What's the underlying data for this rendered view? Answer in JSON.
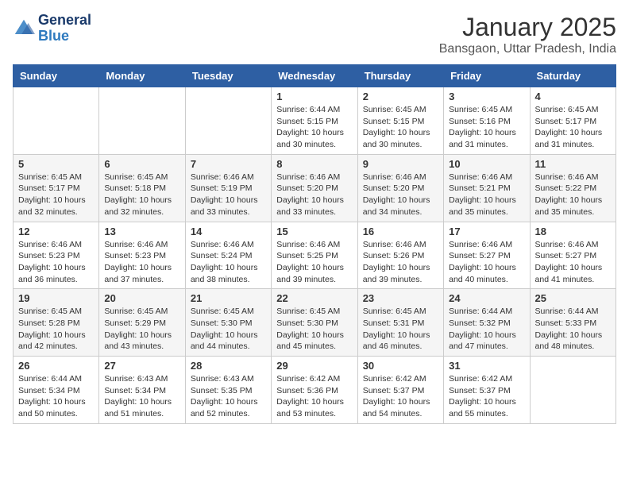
{
  "header": {
    "logo_line1": "General",
    "logo_line2": "Blue",
    "month": "January 2025",
    "location": "Bansgaon, Uttar Pradesh, India"
  },
  "weekdays": [
    "Sunday",
    "Monday",
    "Tuesday",
    "Wednesday",
    "Thursday",
    "Friday",
    "Saturday"
  ],
  "weeks": [
    [
      {
        "day": "",
        "sunrise": "",
        "sunset": "",
        "daylight": ""
      },
      {
        "day": "",
        "sunrise": "",
        "sunset": "",
        "daylight": ""
      },
      {
        "day": "",
        "sunrise": "",
        "sunset": "",
        "daylight": ""
      },
      {
        "day": "1",
        "sunrise": "Sunrise: 6:44 AM",
        "sunset": "Sunset: 5:15 PM",
        "daylight": "Daylight: 10 hours and 30 minutes."
      },
      {
        "day": "2",
        "sunrise": "Sunrise: 6:45 AM",
        "sunset": "Sunset: 5:15 PM",
        "daylight": "Daylight: 10 hours and 30 minutes."
      },
      {
        "day": "3",
        "sunrise": "Sunrise: 6:45 AM",
        "sunset": "Sunset: 5:16 PM",
        "daylight": "Daylight: 10 hours and 31 minutes."
      },
      {
        "day": "4",
        "sunrise": "Sunrise: 6:45 AM",
        "sunset": "Sunset: 5:17 PM",
        "daylight": "Daylight: 10 hours and 31 minutes."
      }
    ],
    [
      {
        "day": "5",
        "sunrise": "Sunrise: 6:45 AM",
        "sunset": "Sunset: 5:17 PM",
        "daylight": "Daylight: 10 hours and 32 minutes."
      },
      {
        "day": "6",
        "sunrise": "Sunrise: 6:45 AM",
        "sunset": "Sunset: 5:18 PM",
        "daylight": "Daylight: 10 hours and 32 minutes."
      },
      {
        "day": "7",
        "sunrise": "Sunrise: 6:46 AM",
        "sunset": "Sunset: 5:19 PM",
        "daylight": "Daylight: 10 hours and 33 minutes."
      },
      {
        "day": "8",
        "sunrise": "Sunrise: 6:46 AM",
        "sunset": "Sunset: 5:20 PM",
        "daylight": "Daylight: 10 hours and 33 minutes."
      },
      {
        "day": "9",
        "sunrise": "Sunrise: 6:46 AM",
        "sunset": "Sunset: 5:20 PM",
        "daylight": "Daylight: 10 hours and 34 minutes."
      },
      {
        "day": "10",
        "sunrise": "Sunrise: 6:46 AM",
        "sunset": "Sunset: 5:21 PM",
        "daylight": "Daylight: 10 hours and 35 minutes."
      },
      {
        "day": "11",
        "sunrise": "Sunrise: 6:46 AM",
        "sunset": "Sunset: 5:22 PM",
        "daylight": "Daylight: 10 hours and 35 minutes."
      }
    ],
    [
      {
        "day": "12",
        "sunrise": "Sunrise: 6:46 AM",
        "sunset": "Sunset: 5:23 PM",
        "daylight": "Daylight: 10 hours and 36 minutes."
      },
      {
        "day": "13",
        "sunrise": "Sunrise: 6:46 AM",
        "sunset": "Sunset: 5:23 PM",
        "daylight": "Daylight: 10 hours and 37 minutes."
      },
      {
        "day": "14",
        "sunrise": "Sunrise: 6:46 AM",
        "sunset": "Sunset: 5:24 PM",
        "daylight": "Daylight: 10 hours and 38 minutes."
      },
      {
        "day": "15",
        "sunrise": "Sunrise: 6:46 AM",
        "sunset": "Sunset: 5:25 PM",
        "daylight": "Daylight: 10 hours and 39 minutes."
      },
      {
        "day": "16",
        "sunrise": "Sunrise: 6:46 AM",
        "sunset": "Sunset: 5:26 PM",
        "daylight": "Daylight: 10 hours and 39 minutes."
      },
      {
        "day": "17",
        "sunrise": "Sunrise: 6:46 AM",
        "sunset": "Sunset: 5:27 PM",
        "daylight": "Daylight: 10 hours and 40 minutes."
      },
      {
        "day": "18",
        "sunrise": "Sunrise: 6:46 AM",
        "sunset": "Sunset: 5:27 PM",
        "daylight": "Daylight: 10 hours and 41 minutes."
      }
    ],
    [
      {
        "day": "19",
        "sunrise": "Sunrise: 6:45 AM",
        "sunset": "Sunset: 5:28 PM",
        "daylight": "Daylight: 10 hours and 42 minutes."
      },
      {
        "day": "20",
        "sunrise": "Sunrise: 6:45 AM",
        "sunset": "Sunset: 5:29 PM",
        "daylight": "Daylight: 10 hours and 43 minutes."
      },
      {
        "day": "21",
        "sunrise": "Sunrise: 6:45 AM",
        "sunset": "Sunset: 5:30 PM",
        "daylight": "Daylight: 10 hours and 44 minutes."
      },
      {
        "day": "22",
        "sunrise": "Sunrise: 6:45 AM",
        "sunset": "Sunset: 5:30 PM",
        "daylight": "Daylight: 10 hours and 45 minutes."
      },
      {
        "day": "23",
        "sunrise": "Sunrise: 6:45 AM",
        "sunset": "Sunset: 5:31 PM",
        "daylight": "Daylight: 10 hours and 46 minutes."
      },
      {
        "day": "24",
        "sunrise": "Sunrise: 6:44 AM",
        "sunset": "Sunset: 5:32 PM",
        "daylight": "Daylight: 10 hours and 47 minutes."
      },
      {
        "day": "25",
        "sunrise": "Sunrise: 6:44 AM",
        "sunset": "Sunset: 5:33 PM",
        "daylight": "Daylight: 10 hours and 48 minutes."
      }
    ],
    [
      {
        "day": "26",
        "sunrise": "Sunrise: 6:44 AM",
        "sunset": "Sunset: 5:34 PM",
        "daylight": "Daylight: 10 hours and 50 minutes."
      },
      {
        "day": "27",
        "sunrise": "Sunrise: 6:43 AM",
        "sunset": "Sunset: 5:34 PM",
        "daylight": "Daylight: 10 hours and 51 minutes."
      },
      {
        "day": "28",
        "sunrise": "Sunrise: 6:43 AM",
        "sunset": "Sunset: 5:35 PM",
        "daylight": "Daylight: 10 hours and 52 minutes."
      },
      {
        "day": "29",
        "sunrise": "Sunrise: 6:42 AM",
        "sunset": "Sunset: 5:36 PM",
        "daylight": "Daylight: 10 hours and 53 minutes."
      },
      {
        "day": "30",
        "sunrise": "Sunrise: 6:42 AM",
        "sunset": "Sunset: 5:37 PM",
        "daylight": "Daylight: 10 hours and 54 minutes."
      },
      {
        "day": "31",
        "sunrise": "Sunrise: 6:42 AM",
        "sunset": "Sunset: 5:37 PM",
        "daylight": "Daylight: 10 hours and 55 minutes."
      },
      {
        "day": "",
        "sunrise": "",
        "sunset": "",
        "daylight": ""
      }
    ]
  ]
}
